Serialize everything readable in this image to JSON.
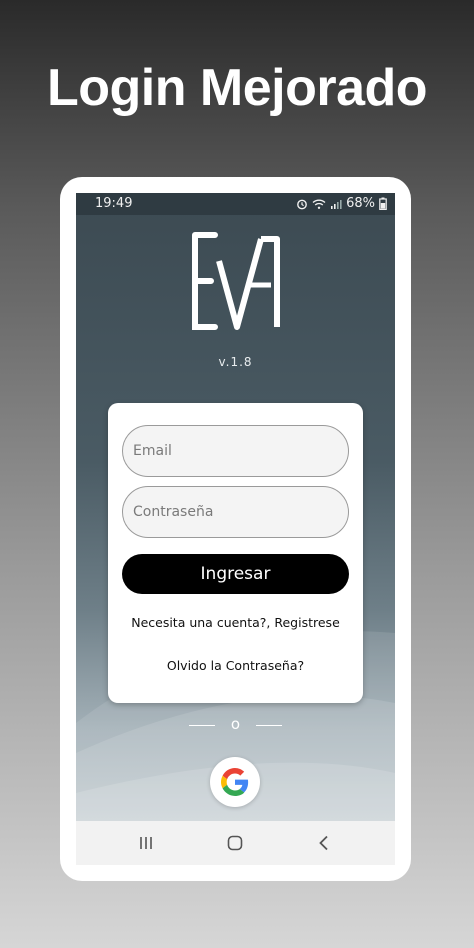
{
  "promo": {
    "title": "Login Mejorado"
  },
  "status_bar": {
    "time": "19:49",
    "battery": "68%"
  },
  "app": {
    "logo_text": "EVA",
    "version": "v.1.8"
  },
  "login_card": {
    "email_placeholder": "Email",
    "password_placeholder": "Contraseña",
    "login_button": "Ingresar",
    "register_link": "Necesita una cuenta?, Registrese",
    "forgot_link": "Olvido la Contraseña?"
  },
  "social": {
    "or_text": "o"
  },
  "colors": {
    "primary_button": "#000000",
    "card": "#ffffff",
    "background": "#3c4a52"
  }
}
